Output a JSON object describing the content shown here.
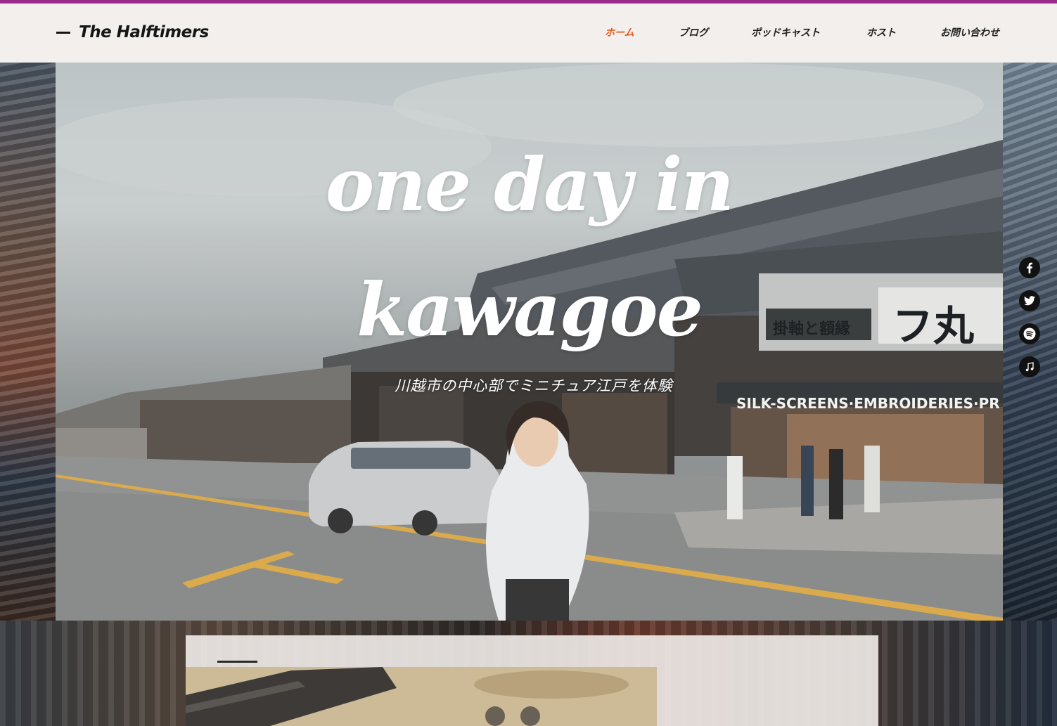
{
  "header": {
    "brand": "The Halftimers",
    "nav": [
      {
        "label": "ホーム",
        "active": true
      },
      {
        "label": "ブログ",
        "active": false
      },
      {
        "label": "ポッドキャスト",
        "active": false
      },
      {
        "label": "ホスト",
        "active": false
      },
      {
        "label": "お問い合わせ",
        "active": false
      }
    ]
  },
  "hero": {
    "title_line1": "one day in",
    "title_line2": "kawagoe",
    "subtitle": "川越市の中心部でミニチュア江戸を体験",
    "signs": {
      "shop_sign": "掛軸と額縁",
      "shop_sign_large": "フ丸",
      "banner": "SILK-SCREENS·EMBROIDERIES·PR"
    }
  },
  "social": [
    {
      "icon": "facebook-icon",
      "glyph": "f"
    },
    {
      "icon": "twitter-icon",
      "glyph": "t"
    },
    {
      "icon": "spotify-icon",
      "glyph": "s"
    },
    {
      "icon": "apple-podcasts-icon",
      "glyph": "♫"
    }
  ],
  "colors": {
    "accent_bar": "#9b2c8e",
    "active_nav": "#e05a1e",
    "header_bg": "#f2efec"
  }
}
